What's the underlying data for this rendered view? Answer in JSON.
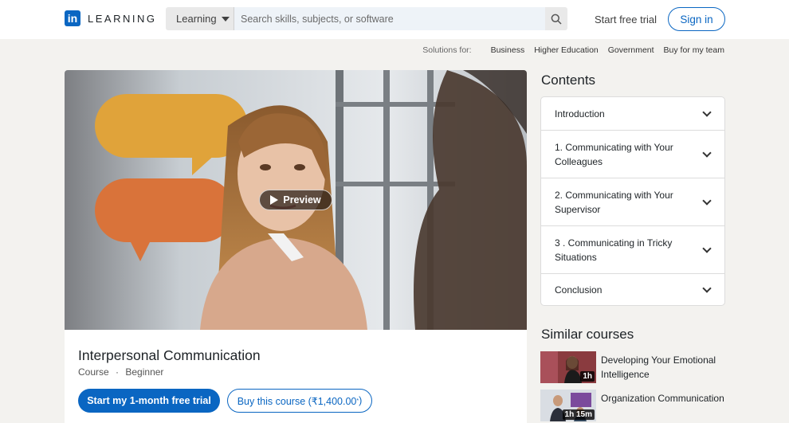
{
  "header": {
    "logo_mark": "in",
    "logo_text": "LEARNING",
    "search_category": "Learning",
    "search_placeholder": "Search skills, subjects, or software",
    "start_trial": "Start free trial",
    "sign_in": "Sign in"
  },
  "subnav": {
    "solutions_for": "Solutions for:",
    "items": [
      "Business",
      "Higher Education",
      "Government",
      "Buy for my team"
    ]
  },
  "hero": {
    "preview_label": "Preview"
  },
  "course": {
    "title": "Interpersonal Communication",
    "type": "Course",
    "separator": "·",
    "level": "Beginner",
    "trial_button": "Start my 1-month free trial",
    "buy_button": "Buy this course (₹1,400.00",
    "buy_button_sup": "*",
    "buy_button_close": ")"
  },
  "contents": {
    "title": "Contents",
    "chapters": [
      "Introduction",
      "1. Communicating with Your Colleagues",
      "2. Communicating with Your Supervisor",
      "3 . Communicating in Tricky Situations",
      "Conclusion"
    ]
  },
  "similar": {
    "title": "Similar courses",
    "items": [
      {
        "title": "Developing Your Emotional Intelligence",
        "duration": "1h"
      },
      {
        "title": "Organization Communication",
        "duration": "1h 15m"
      }
    ]
  },
  "colors": {
    "brand_blue": "#0a66c2",
    "speech_orange": "#e0a33a",
    "speech_rust": "#d9733a"
  }
}
